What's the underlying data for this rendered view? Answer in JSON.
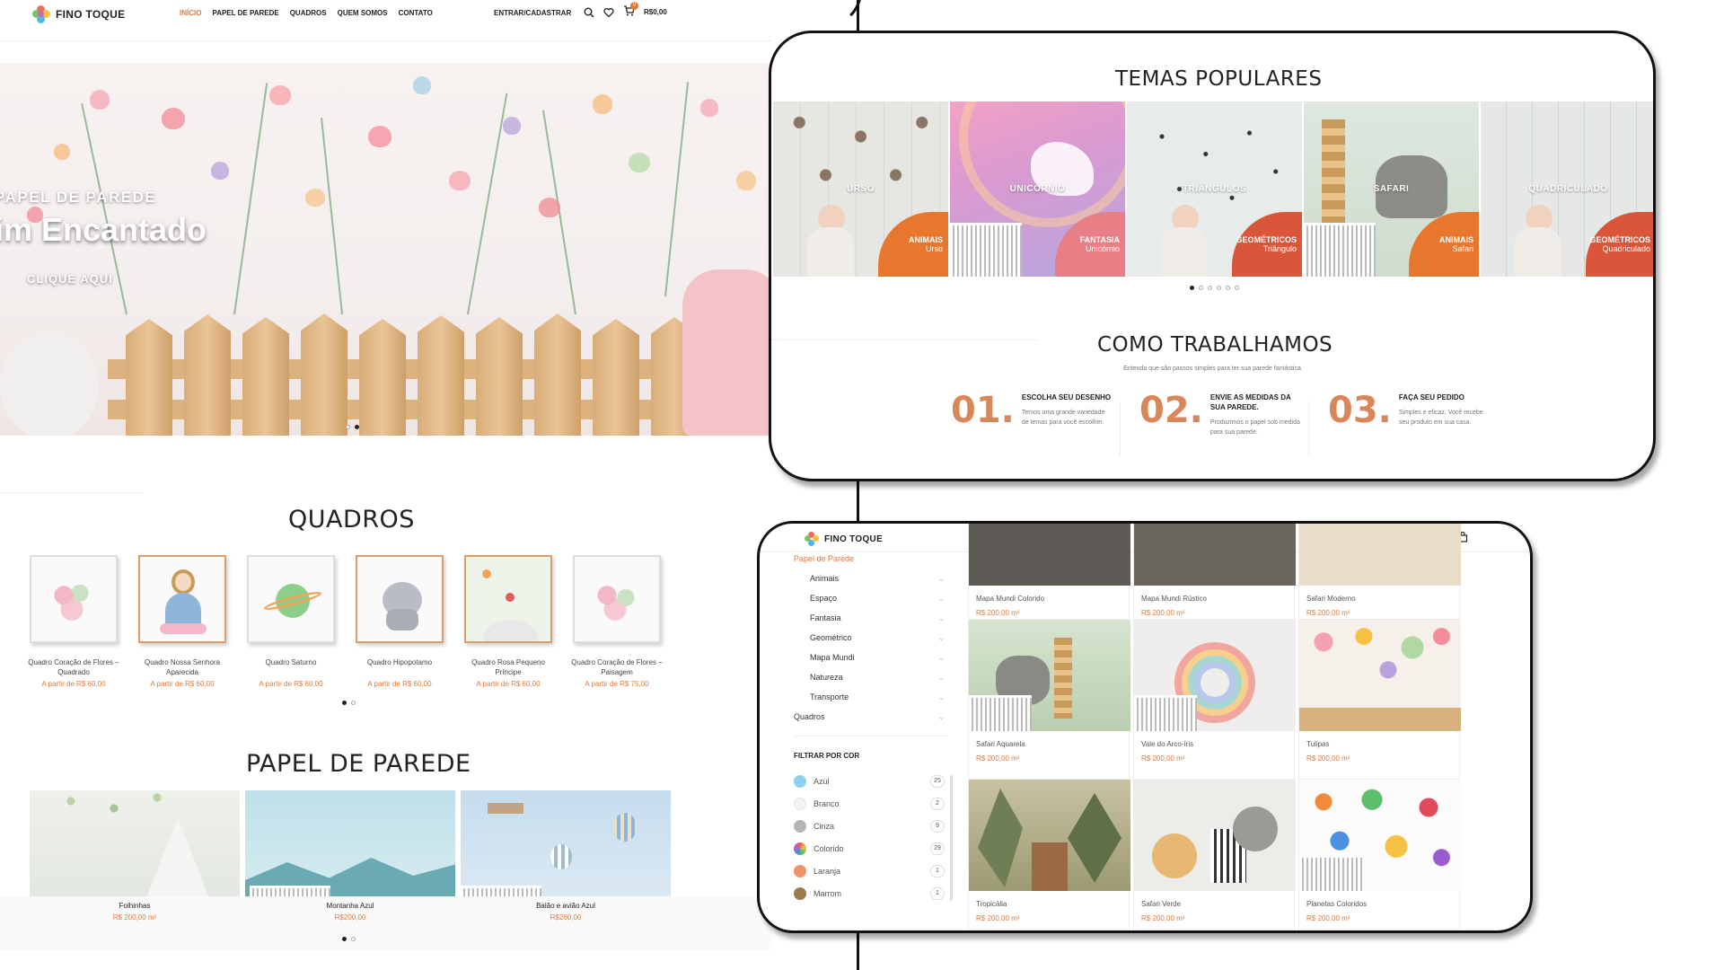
{
  "site": {
    "brand": "FINO TOQUE",
    "nav": [
      "INÍCIO",
      "PAPEL DE PAREDE",
      "QUADROS",
      "QUEM SOMOS",
      "CONTATO"
    ],
    "account": "ENTRAR/CADASTRAR",
    "cart_total": "R$0,00",
    "cart_count": "0",
    "icons": [
      "search-icon",
      "heart-icon",
      "cart-icon"
    ],
    "hero": {
      "subtitle": "PAPEL DE PAREDE",
      "title": "im Encantado",
      "cta": "CLIQUE AQUI"
    },
    "quadros": {
      "title": "QUADROS",
      "items": [
        {
          "name": "Quadro Coração de Flores – Quadrado",
          "price": "A partir de R$ 60,00"
        },
        {
          "name": "Quadro Nossa Senhora Aparecida",
          "price": "A partir de R$ 60,00"
        },
        {
          "name": "Quadro Saturno",
          "price": "A partir de R$ 60,00"
        },
        {
          "name": "Quadro Hipopotamo",
          "price": "A partir de R$ 60,00"
        },
        {
          "name": "Quadro Rosa Pequeno Príncipe",
          "price": "A partir de R$ 60,00"
        },
        {
          "name": "Quadro Coração de Flores – Paisagem",
          "price": "A partir de R$ 75,00"
        }
      ]
    },
    "papel": {
      "title": "PAPEL DE PAREDE",
      "items": [
        {
          "name": "Folhinhas",
          "price": "R$ 200,00 m²"
        },
        {
          "name": "Montanha Azul",
          "price": "R$200,00"
        },
        {
          "name": "Balão e avião Azul",
          "price": "R$260,00"
        }
      ]
    }
  },
  "popular": {
    "title": "TEMAS POPULARES",
    "themes": [
      {
        "name": "URSO",
        "category": "ANIMAIS",
        "sub": "Urso",
        "color": "#e8772e"
      },
      {
        "name": "UNICÓRNIO",
        "category": "FANTASIA",
        "sub": "Unicórnio",
        "color": "#e97f86"
      },
      {
        "name": "TRIÂNGULOS",
        "category": "GEOMÉTRICOS",
        "sub": "Triângulo",
        "color": "#d9563a"
      },
      {
        "name": "SAFARI",
        "category": "ANIMAIS",
        "sub": "Safari",
        "color": "#e8772e"
      },
      {
        "name": "QUADRICULADO",
        "category": "GEOMÉTRICOS",
        "sub": "Quadriculado",
        "color": "#d9563a"
      }
    ]
  },
  "how": {
    "title": "COMO TRABALHAMOS",
    "subtitle": "Entenda que são passos simples para ter sua parede fantástica",
    "steps": [
      {
        "num": "01.",
        "title": "ESCOLHA SEU DESENHO",
        "desc": "Temos uma grande variedade de temas para você escolher."
      },
      {
        "num": "02.",
        "title": "ENVIE AS MEDIDAS DA SUA PAREDE.",
        "desc": "Produzimos o papel sob medida para sua parede."
      },
      {
        "num": "03.",
        "title": "FAÇA SEU PEDIDO",
        "desc": "Simples e eficaz. Você recebe seu produto em sua casa."
      }
    ]
  },
  "shop": {
    "brand": "FINO TOQUE",
    "section": "Papel de Parede",
    "categories": [
      "Animais",
      "Espaço",
      "Fantasia",
      "Geométrico",
      "Mapa Mundi",
      "Natureza",
      "Transporte"
    ],
    "quadros_link": "Quadros",
    "filter_title": "FILTRAR POR COR",
    "colors": [
      {
        "name": "Azul",
        "count": "25",
        "hex": "#8fd0f0"
      },
      {
        "name": "Branco",
        "count": "2",
        "hex": "#f4f4f4"
      },
      {
        "name": "Cinza",
        "count": "9",
        "hex": "#b5b5b5"
      },
      {
        "name": "Colorido",
        "count": "29",
        "hex": "#e06060"
      },
      {
        "name": "Laranja",
        "count": "1",
        "hex": "#f0926a"
      },
      {
        "name": "Marrom",
        "count": "1",
        "hex": "#a07850"
      }
    ],
    "products": [
      {
        "name": "Mapa Mundi Colorido",
        "price": "R$ 200,00 m²"
      },
      {
        "name": "Mapa Mundi Rústico",
        "price": "R$ 200,00 m²"
      },
      {
        "name": "Safari Moderno",
        "price": "R$ 200,00 m²"
      },
      {
        "name": "Safari Aquarela",
        "price": "R$ 200,00 m²"
      },
      {
        "name": "Vale do Arco-íris",
        "price": "R$ 200,00 m²"
      },
      {
        "name": "Tulipas",
        "price": "R$ 200,00 m²"
      },
      {
        "name": "Tropicália",
        "price": "R$ 200,00 m²"
      },
      {
        "name": "Safari Verde",
        "price": "R$ 200,00 m²"
      },
      {
        "name": "Planetas Coloridos",
        "price": "R$ 200,00 m²"
      }
    ]
  }
}
